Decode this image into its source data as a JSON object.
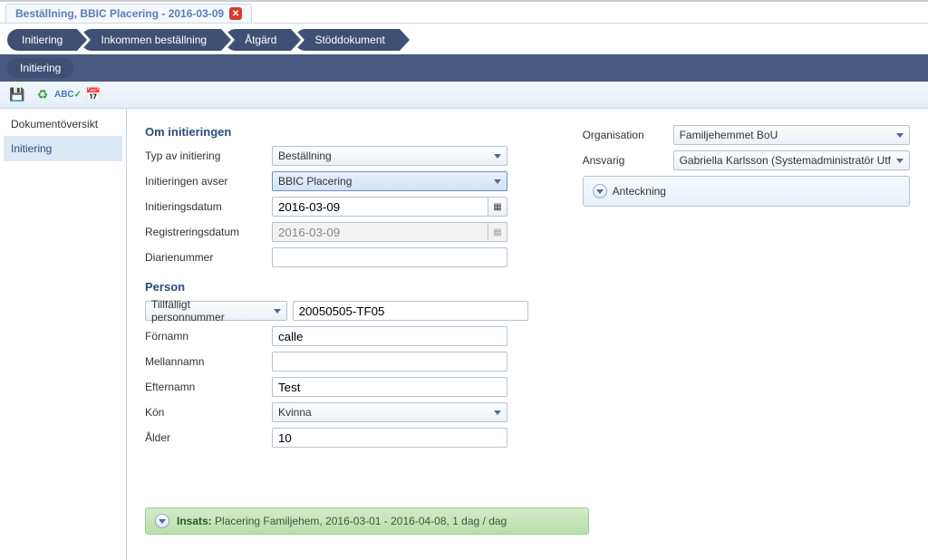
{
  "tab": {
    "title": "Beställning, BBIC Placering - 2016-03-09"
  },
  "breadcrumb": [
    "Initiering",
    "Inkommen beställning",
    "Åtgärd",
    "Stöddokument"
  ],
  "subnav": "Initiering",
  "toolbar_icons": [
    "save-icon",
    "refresh-icon",
    "spellcheck-icon",
    "calendar-icon"
  ],
  "sidebar": {
    "items": [
      "Dokumentöversikt",
      "Initiering"
    ],
    "active": 1
  },
  "sections": {
    "initiering": {
      "title": "Om initieringen",
      "typ_label": "Typ av initiering",
      "typ_value": "Beställning",
      "avser_label": "Initieringen avser",
      "avser_value": "BBIC Placering",
      "initdatum_label": "Initieringsdatum",
      "initdatum_value": "2016-03-09",
      "regdatum_label": "Registreringsdatum",
      "regdatum_value": "2016-03-09",
      "diarie_label": "Diarienummer",
      "diarie_value": ""
    },
    "right": {
      "org_label": "Organisation",
      "org_value": "Familjehemmet BoU",
      "ansvarig_label": "Ansvarig",
      "ansvarig_value": "Gabriella Karlsson (Systemadministratör Utf",
      "notes_label": "Anteckning"
    },
    "person": {
      "title": "Person",
      "idtype": "Tillfälligt personnummer",
      "idvalue": "20050505-TF05",
      "fornamn_label": "Förnamn",
      "fornamn_value": "calle",
      "mellan_label": "Mellannamn",
      "mellan_value": "",
      "efternamn_label": "Efternamn",
      "efternamn_value": "Test",
      "kon_label": "Kön",
      "kon_value": "Kvinna",
      "alder_label": "Ålder",
      "alder_value": "10"
    },
    "insats": {
      "label": "Insats:",
      "text": "Placering Familjehem, 2016-03-01 - 2016-04-08, 1 dag / dag"
    }
  }
}
